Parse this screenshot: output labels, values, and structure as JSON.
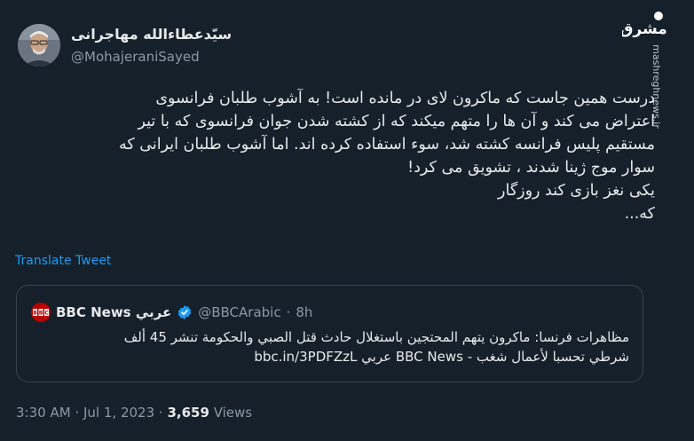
{
  "author": {
    "display_name": "سیّدعطاءالله مهاجرانی",
    "handle": "@MohajeraniSayed"
  },
  "watermark": {
    "logo_text": "مشرق",
    "url_text": "mashreghnews.ir"
  },
  "tweet": {
    "lines": [
      "درست همین جاست که ماکرون لای  در مانده است! به آشوب طلبان فرانسوی",
      "اعتراض می کند و آن ها را متهم میکند که از کشته شدن جوان فرانسوی که با تیر",
      "مستقیم پلیس فرانسه کشته شد، سوء استفاده کرده اند. اما آشوب طلبان ایرانی که",
      "سوار موج ژینا شدند ، تشویق می کرد!",
      "یکی نغز بازی کند روزگار",
      "که..."
    ],
    "translate_label": "Translate Tweet"
  },
  "quote": {
    "name": "BBC News عربي",
    "handle": "@BBCArabic",
    "separator": "·",
    "time": "8h",
    "logo_text": "BBC",
    "text_lines": [
      "مظاهرات فرنسا: ماكرون يتهم المحتجين باستغلال حادث قتل الصبي والحكومة تنشر 45 ألف",
      "شرطي تحسبا لأعمال شغب - BBC News عربي bbc.in/3PDFZzL"
    ]
  },
  "meta": {
    "time": "3:30 AM",
    "separator": "·",
    "date": "Jul 1, 2023",
    "views_count": "3,659",
    "views_label": "Views"
  },
  "colors": {
    "background": "#15202b",
    "text_primary": "#e7e9ea",
    "text_secondary": "#8b98a5",
    "link": "#1d9bf0",
    "border": "#38444d",
    "bbc_red": "#b80000"
  }
}
